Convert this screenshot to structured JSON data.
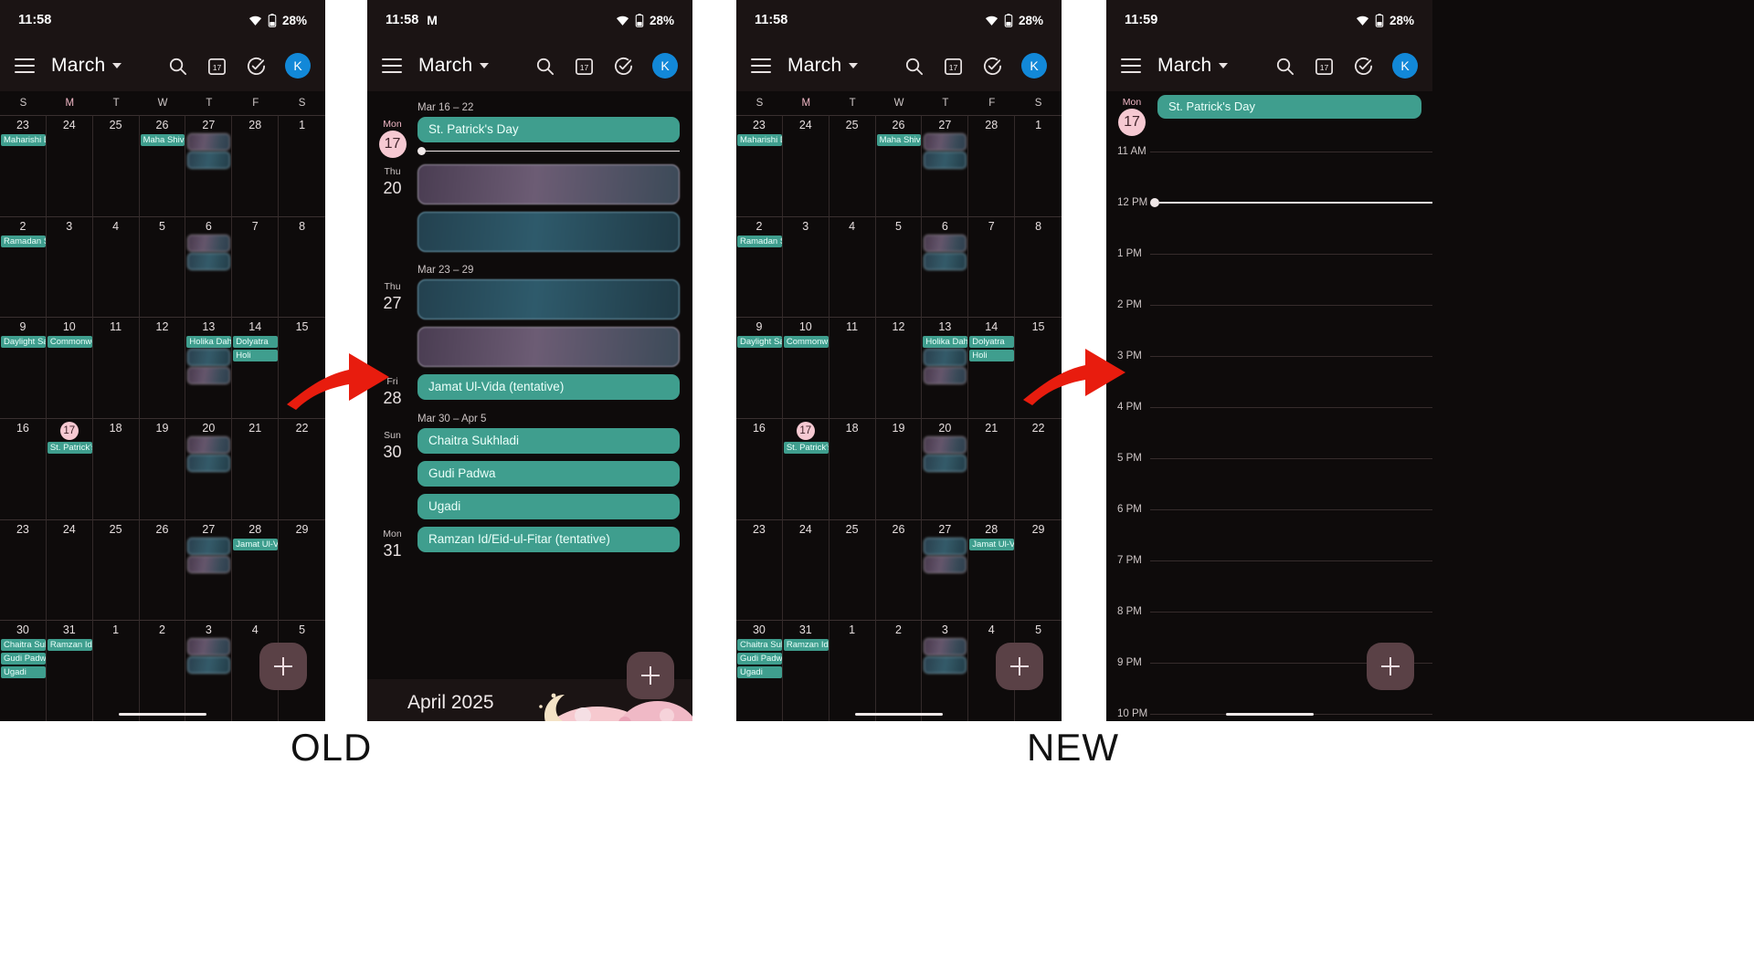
{
  "meta": {
    "labels": {
      "old": "OLD",
      "new": "NEW"
    }
  },
  "panel1": {
    "status": {
      "time": "11:58",
      "battery": "28%"
    },
    "appbar": {
      "title": "March",
      "avatar": "K",
      "search_icon": "search-icon",
      "today_icon": "calendar-17-icon",
      "tasks_icon": "check-circle-icon"
    },
    "dow": [
      "S",
      "M",
      "T",
      "W",
      "T",
      "F",
      "S"
    ],
    "weeks": [
      [
        {
          "n": "23",
          "chips": [
            "Maharishi D"
          ],
          "blurs": []
        },
        {
          "n": "24",
          "chips": [],
          "blurs": []
        },
        {
          "n": "25",
          "chips": [],
          "blurs": []
        },
        {
          "n": "26",
          "chips": [
            "Maha Shiva"
          ],
          "blurs": []
        },
        {
          "n": "27",
          "chips": [],
          "blurs": [
            "a",
            "b"
          ]
        },
        {
          "n": "28",
          "chips": [],
          "blurs": []
        },
        {
          "n": "1",
          "chips": [],
          "blurs": []
        }
      ],
      [
        {
          "n": "2",
          "chips": [
            "Ramadan S"
          ],
          "blurs": []
        },
        {
          "n": "3",
          "chips": [],
          "blurs": []
        },
        {
          "n": "4",
          "chips": [],
          "blurs": []
        },
        {
          "n": "5",
          "chips": [],
          "blurs": []
        },
        {
          "n": "6",
          "chips": [],
          "blurs": [
            "a",
            "b"
          ]
        },
        {
          "n": "7",
          "chips": [],
          "blurs": []
        },
        {
          "n": "8",
          "chips": [],
          "blurs": []
        }
      ],
      [
        {
          "n": "9",
          "chips": [
            "Daylight Sa"
          ],
          "blurs": []
        },
        {
          "n": "10",
          "chips": [
            "Commonwe"
          ],
          "blurs": []
        },
        {
          "n": "11",
          "chips": [],
          "blurs": []
        },
        {
          "n": "12",
          "chips": [],
          "blurs": []
        },
        {
          "n": "13",
          "chips": [
            "Holika Dah"
          ],
          "blurs": [
            "b",
            "a"
          ]
        },
        {
          "n": "14",
          "chips": [
            "Dolyatra",
            "Holi"
          ],
          "blurs": []
        },
        {
          "n": "15",
          "chips": [],
          "blurs": []
        }
      ],
      [
        {
          "n": "16",
          "chips": [],
          "blurs": []
        },
        {
          "n": "17",
          "today": true,
          "chips": [
            "St. Patrick's"
          ],
          "blurs": []
        },
        {
          "n": "18",
          "chips": [],
          "blurs": []
        },
        {
          "n": "19",
          "chips": [],
          "blurs": []
        },
        {
          "n": "20",
          "chips": [],
          "blurs": [
            "a",
            "b"
          ]
        },
        {
          "n": "21",
          "chips": [],
          "blurs": []
        },
        {
          "n": "22",
          "chips": [],
          "blurs": []
        }
      ],
      [
        {
          "n": "23",
          "chips": [],
          "blurs": []
        },
        {
          "n": "24",
          "chips": [],
          "blurs": []
        },
        {
          "n": "25",
          "chips": [],
          "blurs": []
        },
        {
          "n": "26",
          "chips": [],
          "blurs": []
        },
        {
          "n": "27",
          "chips": [],
          "blurs": [
            "b",
            "a"
          ]
        },
        {
          "n": "28",
          "chips": [
            "Jamat Ul-V"
          ],
          "blurs": []
        },
        {
          "n": "29",
          "chips": [],
          "blurs": []
        }
      ],
      [
        {
          "n": "30",
          "chips": [
            "Chaitra Suk",
            "Gudi Padwa",
            "Ugadi"
          ],
          "blurs": []
        },
        {
          "n": "31",
          "chips": [
            "Ramzan Id/"
          ],
          "blurs": []
        },
        {
          "n": "1",
          "chips": [],
          "blurs": []
        },
        {
          "n": "2",
          "chips": [],
          "blurs": []
        },
        {
          "n": "3",
          "chips": [],
          "blurs": [
            "a",
            "b"
          ]
        },
        {
          "n": "4",
          "chips": [],
          "blurs": []
        },
        {
          "n": "5",
          "chips": [],
          "blurs": []
        }
      ]
    ]
  },
  "panel2": {
    "status": {
      "time": "11:58",
      "battery": "28%",
      "gmail": "M"
    },
    "appbar": {
      "title": "March",
      "avatar": "K"
    },
    "groups": [
      {
        "header": "Mar 16 – 22",
        "days": [
          {
            "dow": "Mon",
            "num": "17",
            "today": true,
            "events": [
              {
                "type": "holiday",
                "label": "St. Patrick's Day"
              }
            ],
            "now": true
          },
          {
            "dow": "Thu",
            "num": "20",
            "events": [
              {
                "type": "blur",
                "tint": "purple"
              },
              {
                "type": "blur",
                "tint": "blue"
              }
            ]
          }
        ]
      },
      {
        "header": "Mar 23 – 29",
        "days": [
          {
            "dow": "Thu",
            "num": "27",
            "events": [
              {
                "type": "blur",
                "tint": "blue"
              },
              {
                "type": "blur",
                "tint": "purple"
              }
            ]
          },
          {
            "dow": "Fri",
            "num": "28",
            "events": [
              {
                "type": "holiday",
                "label": "Jamat Ul-Vida (tentative)"
              }
            ]
          }
        ]
      },
      {
        "header": "Mar 30 – Apr 5",
        "days": [
          {
            "dow": "Sun",
            "num": "30",
            "events": [
              {
                "type": "holiday",
                "label": "Chaitra Sukhladi"
              },
              {
                "type": "holiday",
                "label": "Gudi Padwa"
              },
              {
                "type": "holiday",
                "label": "Ugadi"
              }
            ]
          },
          {
            "dow": "Mon",
            "num": "31",
            "events": [
              {
                "type": "holiday",
                "label": "Ramzan Id/Eid-ul-Fitar (tentative)"
              }
            ]
          }
        ]
      }
    ],
    "next_month": "April 2025"
  },
  "panel3": {
    "status": {
      "time": "11:58",
      "battery": "28%"
    },
    "appbar": {
      "title": "March",
      "avatar": "K"
    },
    "dow": [
      "S",
      "M",
      "T",
      "W",
      "T",
      "F",
      "S"
    ],
    "weeks": [
      [
        {
          "n": "23",
          "chips": [
            "Maharishi D"
          ],
          "blurs": []
        },
        {
          "n": "24",
          "chips": [],
          "blurs": []
        },
        {
          "n": "25",
          "chips": [],
          "blurs": []
        },
        {
          "n": "26",
          "chips": [
            "Maha Shiva"
          ],
          "blurs": []
        },
        {
          "n": "27",
          "chips": [],
          "blurs": [
            "a",
            "b"
          ]
        },
        {
          "n": "28",
          "chips": [],
          "blurs": []
        },
        {
          "n": "1",
          "chips": [],
          "blurs": []
        }
      ],
      [
        {
          "n": "2",
          "chips": [
            "Ramadan S"
          ],
          "blurs": []
        },
        {
          "n": "3",
          "chips": [],
          "blurs": []
        },
        {
          "n": "4",
          "chips": [],
          "blurs": []
        },
        {
          "n": "5",
          "chips": [],
          "blurs": []
        },
        {
          "n": "6",
          "chips": [],
          "blurs": [
            "a",
            "b"
          ]
        },
        {
          "n": "7",
          "chips": [],
          "blurs": []
        },
        {
          "n": "8",
          "chips": [],
          "blurs": []
        }
      ],
      [
        {
          "n": "9",
          "chips": [
            "Daylight Sa"
          ],
          "blurs": []
        },
        {
          "n": "10",
          "chips": [
            "Commonw"
          ],
          "blurs": []
        },
        {
          "n": "11",
          "chips": [],
          "blurs": []
        },
        {
          "n": "12",
          "chips": [],
          "blurs": []
        },
        {
          "n": "13",
          "chips": [
            "Holika Dah"
          ],
          "blurs": [
            "b",
            "a"
          ]
        },
        {
          "n": "14",
          "chips": [
            "Dolyatra",
            "Holi"
          ],
          "blurs": []
        },
        {
          "n": "15",
          "chips": [],
          "blurs": []
        }
      ],
      [
        {
          "n": "16",
          "chips": [],
          "blurs": []
        },
        {
          "n": "17",
          "today": true,
          "chips": [
            "St. Patrick's"
          ],
          "blurs": []
        },
        {
          "n": "18",
          "chips": [],
          "blurs": []
        },
        {
          "n": "19",
          "chips": [],
          "blurs": []
        },
        {
          "n": "20",
          "chips": [],
          "blurs": [
            "a",
            "b"
          ]
        },
        {
          "n": "21",
          "chips": [],
          "blurs": []
        },
        {
          "n": "22",
          "chips": [],
          "blurs": []
        }
      ],
      [
        {
          "n": "23",
          "chips": [],
          "blurs": []
        },
        {
          "n": "24",
          "chips": [],
          "blurs": []
        },
        {
          "n": "25",
          "chips": [],
          "blurs": []
        },
        {
          "n": "26",
          "chips": [],
          "blurs": []
        },
        {
          "n": "27",
          "chips": [],
          "blurs": [
            "b",
            "a"
          ]
        },
        {
          "n": "28",
          "chips": [
            "Jamat Ul-V"
          ],
          "blurs": []
        },
        {
          "n": "29",
          "chips": [],
          "blurs": []
        }
      ],
      [
        {
          "n": "30",
          "chips": [
            "Chaitra Suk",
            "Gudi Padwa",
            "Ugadi"
          ],
          "blurs": []
        },
        {
          "n": "31",
          "chips": [
            "Ramzan Id/"
          ],
          "blurs": []
        },
        {
          "n": "1",
          "chips": [],
          "blurs": []
        },
        {
          "n": "2",
          "chips": [],
          "blurs": []
        },
        {
          "n": "3",
          "chips": [],
          "blurs": [
            "a",
            "b"
          ]
        },
        {
          "n": "4",
          "chips": [],
          "blurs": []
        },
        {
          "n": "5",
          "chips": [],
          "blurs": []
        }
      ]
    ]
  },
  "panel4": {
    "status": {
      "time": "11:59",
      "battery": "28%"
    },
    "appbar": {
      "title": "March",
      "avatar": "K"
    },
    "day": {
      "dow": "Mon",
      "num": "17",
      "allday": "St. Patrick's Day"
    },
    "times": [
      "11 AM",
      "12 PM",
      "1 PM",
      "2 PM",
      "3 PM",
      "4 PM",
      "5 PM",
      "6 PM",
      "7 PM",
      "8 PM",
      "9 PM",
      "10 PM"
    ],
    "now_time": "12 PM"
  },
  "colors": {
    "holiday": "#3f9e8e",
    "today_pill": "#f6c9d2",
    "avatar": "#1288d8",
    "arrow": "#e81c0e",
    "fab": "#5a4146",
    "surface": "#0e0b0b",
    "appbar": "#1b1414"
  }
}
